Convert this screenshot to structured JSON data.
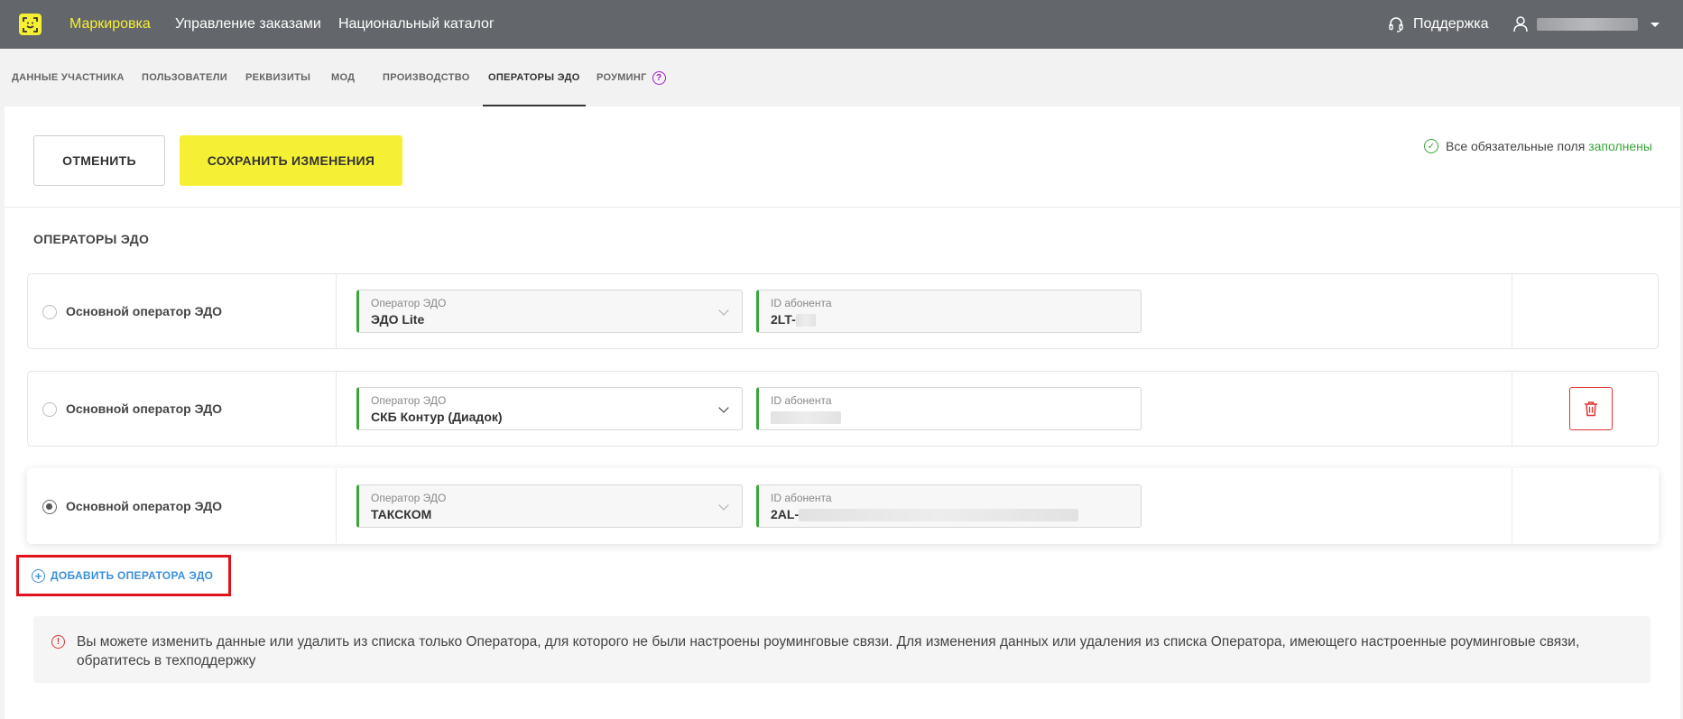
{
  "header": {
    "nav": [
      "Маркировка",
      "Управление заказами",
      "Национальный каталог"
    ],
    "support": "Поддержка"
  },
  "tabs": [
    "ДАННЫЕ УЧАСТНИКА",
    "ПОЛЬЗОВАТЕЛИ",
    "РЕКВИЗИТЫ",
    "МОД",
    "ПРОИЗВОДСТВО",
    "ОПЕРАТОРЫ ЭДО",
    "РОУМИНГ"
  ],
  "active_tab": "ОПЕРАТОРЫ ЭДО",
  "actions": {
    "cancel": "ОТМЕНИТЬ",
    "save": "СОХРАНИТЬ ИЗМЕНЕНИЯ"
  },
  "status": {
    "text": "Все обязательные поля",
    "ok": "заполнены",
    "color": "#3aa53a"
  },
  "section_title": "ОПЕРАТОРЫ ЭДО",
  "operators": [
    {
      "radio_label": "Основной оператор ЭДО",
      "selected": false,
      "operator_label": "Оператор ЭДО",
      "operator": "ЭДО Lite",
      "id_label": "ID абонента",
      "id_prefix": "2LT-",
      "deletable": false
    },
    {
      "radio_label": "Основной оператор ЭДО",
      "selected": false,
      "operator_label": "Оператор ЭДО",
      "operator": "СКБ Контур (Диадок)",
      "id_label": "ID абонента",
      "id_prefix": "",
      "deletable": true
    },
    {
      "radio_label": "Основной оператор ЭДО",
      "selected": true,
      "operator_label": "Оператор ЭДО",
      "operator": "ТАКСКОМ",
      "id_label": "ID абонента",
      "id_prefix": "2AL-",
      "deletable": false
    }
  ],
  "add_operator": "ДОБАВИТЬ ОПЕРАТОРА ЭДО",
  "notice": "Вы можете изменить данные или удалить из списка только Оператора, для которого не были настроены роуминговые связи. Для изменения данных или удаления из списка Оператора, имеющего настроенные роуминговые связи, обратитесь в техподдержку",
  "colors": {
    "accent": "#f6f035",
    "header_bg": "#63666a",
    "link": "#3b8fd8",
    "danger": "#e03232"
  }
}
